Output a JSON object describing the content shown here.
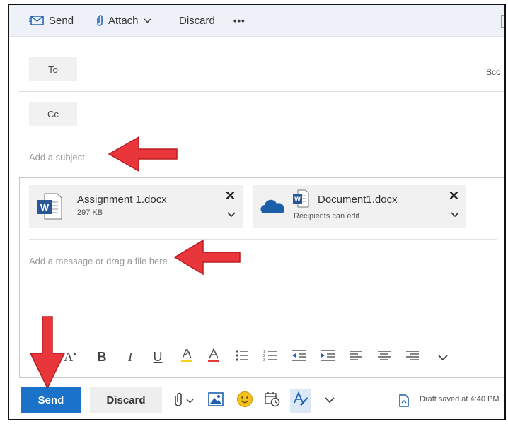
{
  "toolbar": {
    "send_label": "Send",
    "attach_label": "Attach",
    "discard_label": "Discard",
    "more_label": "•••"
  },
  "recipients": {
    "to_label": "To",
    "cc_label": "Cc",
    "bcc_label": "Bcc"
  },
  "subject": {
    "placeholder": "Add a subject"
  },
  "attachments": [
    {
      "name": "Assignment 1.docx",
      "detail": "297 KB",
      "icon": "word-doc-icon"
    },
    {
      "name": "Document1.docx",
      "detail": "Recipients can edit",
      "icon": "onedrive-cloud-icon"
    }
  ],
  "message": {
    "placeholder": "Add a message or drag a file here"
  },
  "format_toolbar": [
    "A",
    "B",
    "I",
    "U"
  ],
  "bottom": {
    "send_label": "Send",
    "discard_label": "Discard",
    "draft_status": "Draft saved at 4:40 PM"
  },
  "colors": {
    "accent": "#1a73c9",
    "arrow": "#e8363a",
    "toolbar_bg": "#eef2f8"
  }
}
